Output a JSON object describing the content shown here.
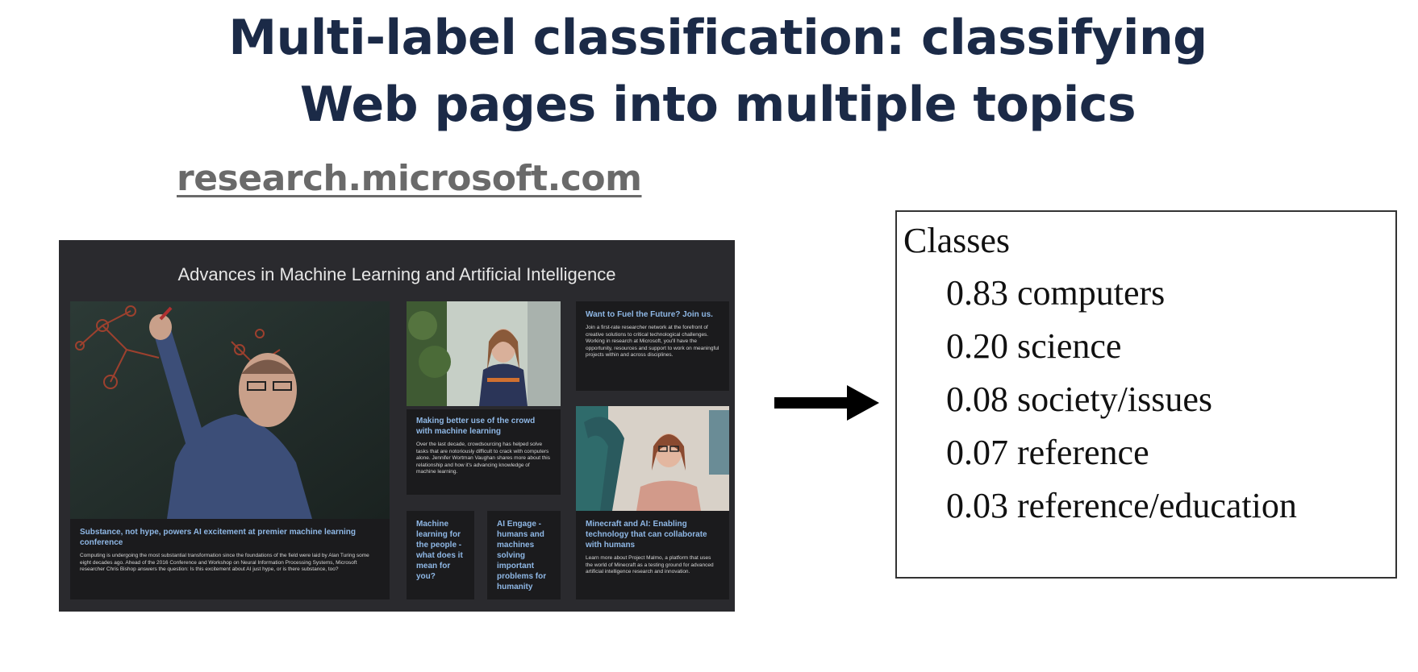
{
  "slide": {
    "title_line1": "Multi-label classification: classifying",
    "title_line2": "Web pages into multiple topics",
    "url": "research.microsoft.com"
  },
  "webpage": {
    "heading": "Advances in Machine Learning and Artificial Intelligence",
    "cards": {
      "main": {
        "title": "Substance, not hype, powers AI excitement at premier machine learning conference",
        "body": "Computing is undergoing the most substantial transformation since the foundations of the field were laid by Alan Turing some eight decades ago. Ahead of the 2016 Conference and Workshop on Neural Information Processing Systems, Microsoft researcher Chris Bishop answers the question: Is this excitement about AI just hype, or is there substance, too?"
      },
      "join": {
        "title": "Want to Fuel the Future? Join us.",
        "body": "Join a first-rate researcher network at the forefront of creative solutions to critical technological challenges. Working in research at Microsoft, you'll have the opportunity, resources and support to work on meaningful projects within and across disciplines."
      },
      "crowd": {
        "title": "Making better use of the crowd with machine learning",
        "body": "Over the last decade, crowdsourcing has helped solve tasks that are notoriously difficult to crack with computers alone. Jennifer Wortman Vaughan shares more about this relationship and how it's advancing knowledge of machine learning."
      },
      "people": {
        "title": "Machine learning for the people - what does it mean for you?"
      },
      "engage": {
        "title": "AI Engage - humans and machines solving important problems for humanity"
      },
      "minecraft": {
        "title": "Minecraft and AI: Enabling technology that can collaborate with humans",
        "body": "Learn more about Project Malmo, a platform that uses the world of Minecraft as a testing ground for advanced artificial intelligence research and innovation."
      }
    }
  },
  "classes": {
    "title": "Classes",
    "items": [
      {
        "score": "0.83",
        "label": "computers"
      },
      {
        "score": "0.20",
        "label": "science"
      },
      {
        "score": "0.08",
        "label": "society/issues"
      },
      {
        "score": "0.07",
        "label": "reference"
      },
      {
        "score": "0.03",
        "label": "reference/education"
      }
    ]
  },
  "colors": {
    "title": "#1b2a47",
    "url": "#6a6a6a",
    "webpage_bg": "#2a2a2e",
    "card_bg": "#1b1b1d",
    "card_title": "#8fb8e6"
  }
}
